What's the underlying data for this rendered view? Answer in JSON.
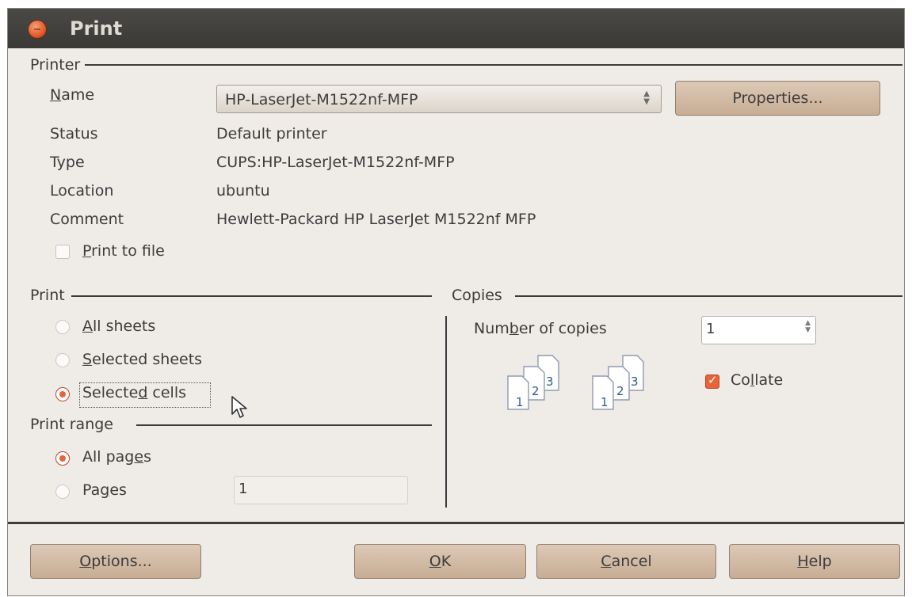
{
  "window": {
    "title": "Print"
  },
  "printer": {
    "section_title": "Printer",
    "name_label": "Name",
    "name_value": "HP-LaserJet-M1522nf-MFP",
    "properties_button": "Properties...",
    "status_label": "Status",
    "status_value": "Default printer",
    "type_label": "Type",
    "type_value": "CUPS:HP-LaserJet-M1522nf-MFP",
    "location_label": "Location",
    "location_value": "ubuntu",
    "comment_label": "Comment",
    "comment_value": "Hewlett-Packard HP LaserJet M1522nf MFP",
    "print_to_file_label": "Print to file",
    "print_to_file_checked": false
  },
  "print": {
    "section_title": "Print",
    "options": [
      {
        "label": "All sheets",
        "selected": false
      },
      {
        "label": "Selected sheets",
        "selected": false
      },
      {
        "label": "Selected cells",
        "selected": true
      }
    ]
  },
  "print_range": {
    "section_title": "Print range",
    "all_pages_label": "All pages",
    "all_pages_selected": true,
    "pages_label": "Pages",
    "pages_value": "1"
  },
  "copies": {
    "section_title": "Copies",
    "number_label": "Number of copies",
    "number_value": "1",
    "collate_label": "Collate",
    "collate_checked": true,
    "page_numbers": [
      "1",
      "2",
      "3"
    ]
  },
  "buttons": {
    "options": "Options...",
    "ok": "OK",
    "cancel": "Cancel",
    "help": "Help"
  },
  "colors": {
    "titlebar": "#3c3b37",
    "accent": "#e8633a",
    "button": "#d3bca6"
  }
}
